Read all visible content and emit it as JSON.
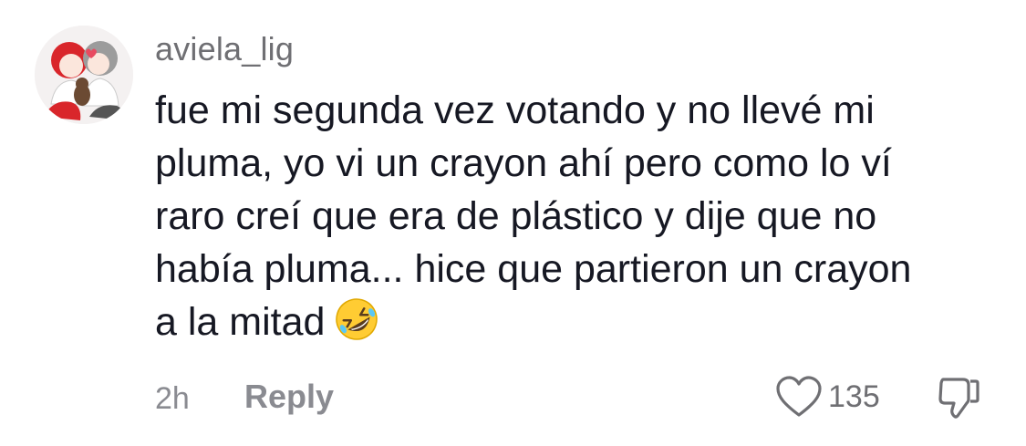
{
  "comment": {
    "username": "aviela_lig",
    "lines": [
      "fue mi segunda vez votando y no llevé mi",
      "pluma, yo vi un crayon ahí pero como lo ví",
      "raro creí que era de plástico y dije que no",
      "había pluma... hice que partieron un crayon",
      "a la mitad"
    ],
    "emoji": "rolling-on-the-floor-laughing",
    "time": "2h",
    "reply_label": "Reply",
    "like_count": "135"
  },
  "icons": {
    "like": "heart-outline-icon",
    "dislike": "thumbs-down-outline-icon"
  },
  "colors": {
    "text_primary": "#161823",
    "text_secondary": "#8a8b91",
    "username": "#6f6f73"
  }
}
